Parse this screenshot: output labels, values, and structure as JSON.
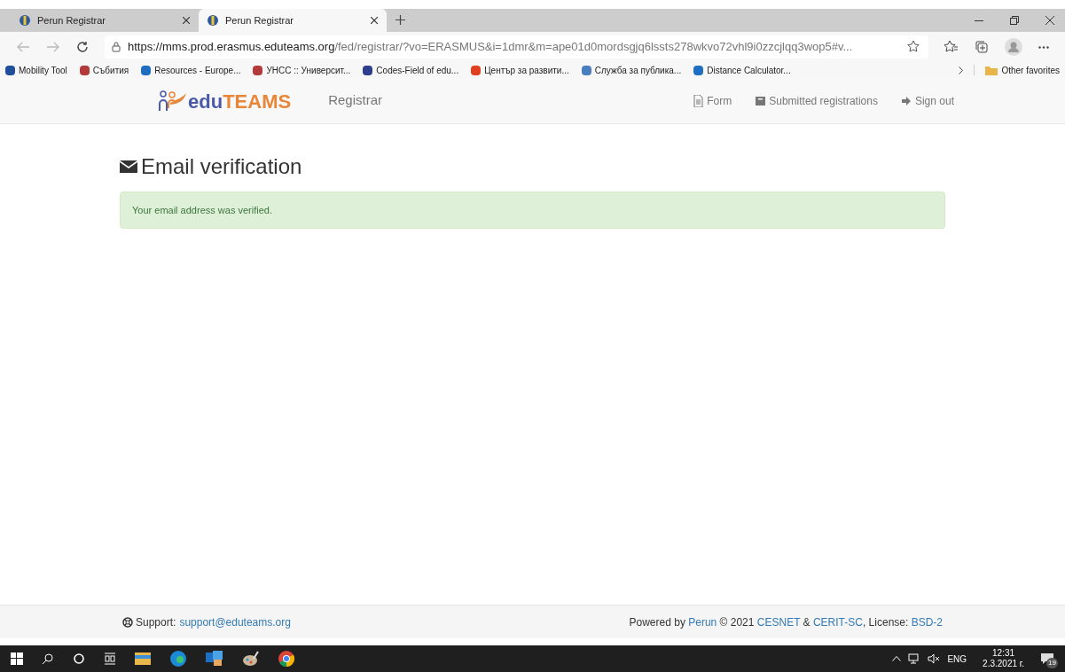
{
  "browser": {
    "tabs": [
      {
        "title": "Perun Registrar",
        "selected": false
      },
      {
        "title": "Perun Registrar",
        "selected": true
      }
    ],
    "url": {
      "host": "https://mms.prod.erasmus.eduteams.org",
      "rest": "/fed/registrar/?vo=ERASMUS&i=1dmr&m=ape01d0mordsgjq6lssts278wkvo72vhl9i0zzcjlqq3wop5#v..."
    },
    "bookmarks": [
      {
        "label": "Mobility Tool",
        "color": "#1f4e9c"
      },
      {
        "label": "Събития",
        "color": "#b33a3a"
      },
      {
        "label": "Resources - Europe...",
        "color": "#1e6fc2"
      },
      {
        "label": "УНСС :: Университ...",
        "color": "#b33a3a"
      },
      {
        "label": "Codes-Field of edu...",
        "color": "#2d3e8c"
      },
      {
        "label": "Център за развити...",
        "color": "#e0401f"
      },
      {
        "label": "Служба за публика...",
        "color": "#4a7fbf"
      },
      {
        "label": "Distance Calculator...",
        "color": "#1e6fc2"
      }
    ],
    "other_favorites": "Other favorites"
  },
  "app": {
    "logo": "eduTEAMS",
    "brand": "Registrar",
    "nav": [
      {
        "label": "Form",
        "kind": "file"
      },
      {
        "label": "Submitted registrations",
        "kind": "box"
      },
      {
        "label": "Sign out",
        "kind": "logout"
      }
    ],
    "heading": "Email verification",
    "alert": "Your email address was verified.",
    "footer": {
      "support_label": "Support:",
      "support_email": "support@eduteams.org",
      "powered": [
        {
          "text": "Powered by ",
          "link": false
        },
        {
          "text": "Perun",
          "link": true
        },
        {
          "text": " © 2021 ",
          "link": false
        },
        {
          "text": "CESNET",
          "link": true
        },
        {
          "text": " & ",
          "link": false
        },
        {
          "text": "CERIT-SC",
          "link": true
        },
        {
          "text": ", License: ",
          "link": false
        },
        {
          "text": "BSD-2",
          "link": true
        }
      ]
    }
  },
  "taskbar": {
    "language": "ENG",
    "time": "12:31",
    "date": "2.3.2021 г.",
    "notifications": "19"
  }
}
